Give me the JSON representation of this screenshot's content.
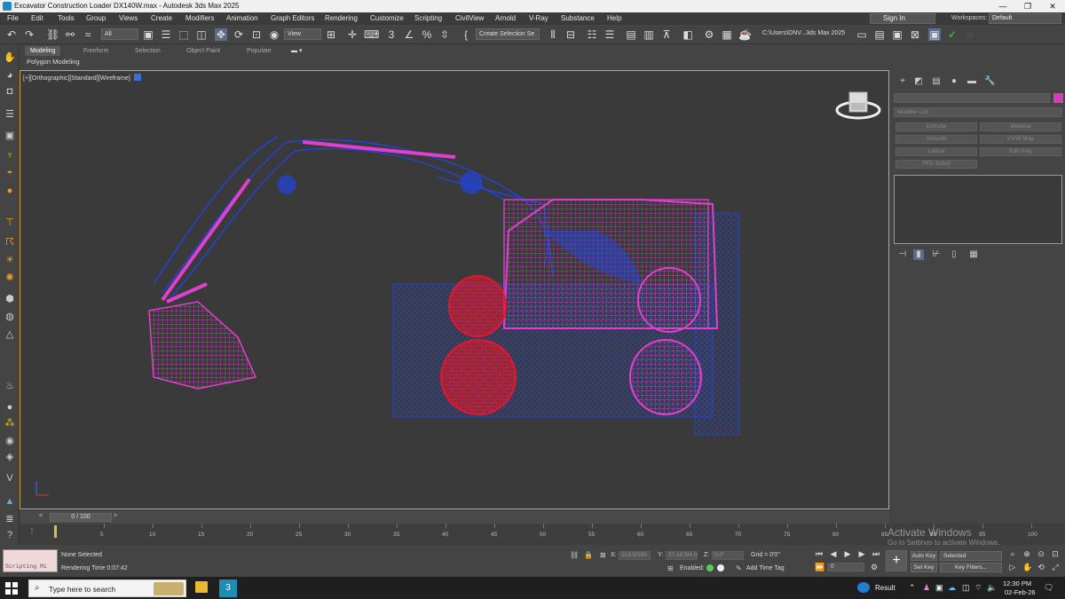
{
  "window": {
    "title": "Excavator Construction Loader DX140W.max - Autodesk 3ds Max 2025"
  },
  "menu": [
    "File",
    "Edit",
    "Tools",
    "Group",
    "Views",
    "Create",
    "Modifiers",
    "Animation",
    "Graph Editors",
    "Rendering",
    "Customize",
    "Scripting",
    "CivilView",
    "Arnold",
    "V-Ray",
    "Substance",
    "Help"
  ],
  "account": {
    "signin_label": "Sign In",
    "workspaces_label": "Workspaces:",
    "workspace_value": "Default"
  },
  "toolbar": {
    "selection_filter": "All",
    "ref_coord": "View",
    "named_selection": "Create Selection Se",
    "project_path": "C:\\Users\\DNV...3ds Max 2025"
  },
  "ribbon": {
    "tabs": [
      "Modeling",
      "Freeform",
      "Selection",
      "Object Paint",
      "Populate"
    ],
    "active_tab": "Modeling",
    "subtitle": "Polygon Modeling"
  },
  "viewport": {
    "label_parts": [
      "[+]",
      "[Orthographic]",
      "[Standard]",
      "[Wireframe]"
    ]
  },
  "command_panel": {
    "modifier_list": "Modifier List",
    "buttons": [
      "Extrude",
      "Material",
      "Smooth",
      "UVW Map",
      "Lattice",
      "Edit Poly",
      "FFD 3x3x3"
    ],
    "object_color": "#d43fb4"
  },
  "timeslider": {
    "label": "0 / 100",
    "prev": "<",
    "next": ">"
  },
  "trackbar": {
    "ticks": [
      "5",
      "10",
      "15",
      "20",
      "25",
      "30",
      "35",
      "40",
      "45",
      "50",
      "55",
      "60",
      "65",
      "70",
      "75",
      "80",
      "85",
      "90",
      "95",
      "100"
    ]
  },
  "status": {
    "script_listener": "Scripting Mi",
    "selection": "None Selected",
    "render_time": "Rendering Time  0:07:42",
    "x_label": "X:",
    "x_value": "213.5/100",
    "y_label": "Y:",
    "y_value": "27.10.5/4.0",
    "z_label": "Z:",
    "z_value": "0.0\"",
    "grid": "Grid = 0'0\"",
    "enabled": "Enabled:",
    "add_time_tag": "Add Time Tag",
    "frame": "0",
    "auto_key": "Auto Key",
    "set_key": "Set Key",
    "key_mode": "Selected",
    "key_filters": "Key Filters..."
  },
  "watermark": {
    "line1": "Activate Windows",
    "line2": "Go to Settings to activate Windows."
  },
  "taskbar": {
    "search_placeholder": "Type here to search",
    "result": "Result",
    "time": "12:30 PM",
    "date": "02-Feb-26"
  },
  "colors": {
    "accent_viewport_border": "#c8a842",
    "wire_blue": "#2244dd",
    "wire_magenta": "#e040d0",
    "wire_red": "#e01830"
  }
}
